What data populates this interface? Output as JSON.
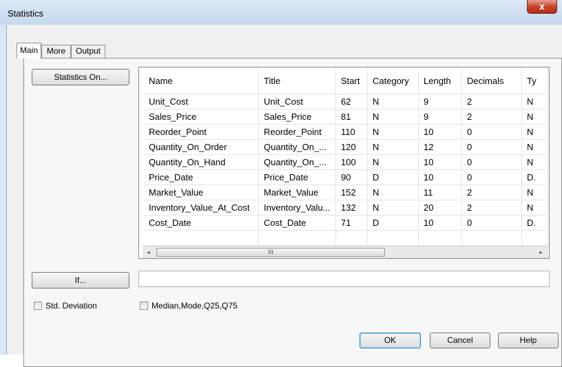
{
  "window": {
    "title": "Statistics",
    "close_symbol": "x"
  },
  "tabs": [
    {
      "label": "Main"
    },
    {
      "label": "More"
    },
    {
      "label": "Output"
    }
  ],
  "buttons": {
    "statistics_on": "Statistics On...",
    "if": "If...",
    "ok": "OK",
    "cancel": "Cancel",
    "help": "Help"
  },
  "grid": {
    "columns": [
      "Name",
      "Title",
      "Start",
      "Category",
      "Length",
      "Decimals",
      "Ty"
    ],
    "rows": [
      [
        "Unit_Cost",
        "Unit_Cost",
        "62",
        "N",
        "9",
        "2",
        "N"
      ],
      [
        "Sales_Price",
        "Sales_Price",
        "81",
        "N",
        "9",
        "2",
        "N"
      ],
      [
        "Reorder_Point",
        "Reorder_Point",
        "110",
        "N",
        "10",
        "0",
        "N"
      ],
      [
        "Quantity_On_Order",
        "Quantity_On_...",
        "120",
        "N",
        "12",
        "0",
        "N"
      ],
      [
        "Quantity_On_Hand",
        "Quantity_On_...",
        "100",
        "N",
        "10",
        "0",
        "N"
      ],
      [
        "Price_Date",
        "Price_Date",
        "90",
        "D",
        "10",
        "0",
        "D."
      ],
      [
        "Market_Value",
        "Market_Value",
        "152",
        "N",
        "11",
        "2",
        "N"
      ],
      [
        "Inventory_Value_At_Cost",
        "Inventory_Valu...",
        "132",
        "N",
        "20",
        "2",
        "N"
      ],
      [
        "Cost_Date",
        "Cost_Date",
        "71",
        "D",
        "10",
        "0",
        "D."
      ]
    ],
    "scroll_left": "◂",
    "scroll_right": "▸",
    "scroll_grip": "III"
  },
  "if_value": "",
  "checkboxes": {
    "std_deviation": {
      "label": "Std. Deviation",
      "checked": false
    },
    "median_mode": {
      "label": "Median,Mode,Q25,Q75",
      "checked": false
    }
  }
}
